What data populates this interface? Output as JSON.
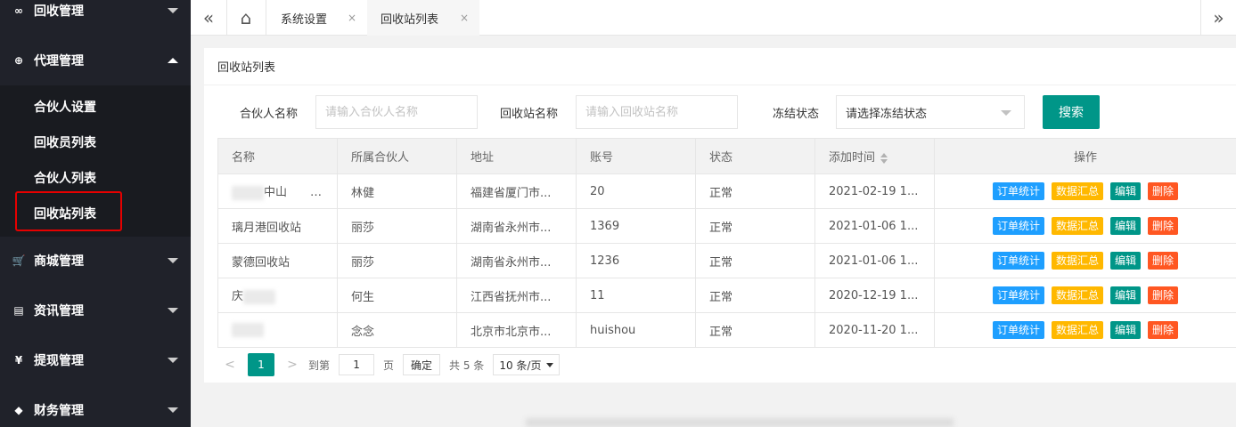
{
  "sidebar": {
    "menus": [
      {
        "label": "回收管理",
        "icon": "∞",
        "expanded": false
      },
      {
        "label": "代理管理",
        "icon": "⊕",
        "expanded": true
      },
      {
        "label": "商城管理",
        "icon": "🛒",
        "expanded": false
      },
      {
        "label": "资讯管理",
        "icon": "▤",
        "expanded": false
      },
      {
        "label": "提现管理",
        "icon": "¥",
        "expanded": false
      },
      {
        "label": "财务管理",
        "icon": "◆",
        "expanded": false
      }
    ],
    "submenu": [
      "合伙人设置",
      "回收员列表",
      "合伙人列表",
      "回收站列表"
    ]
  },
  "topbar": {
    "collapse_icon": "«",
    "home_icon": "⌂",
    "expand_icon": "»",
    "tabs": [
      {
        "label": "系统设置",
        "close": "×"
      },
      {
        "label": "回收站列表",
        "close": "×"
      }
    ]
  },
  "card": {
    "title": "回收站列表",
    "filters": {
      "partner_label": "合伙人名称",
      "partner_placeholder": "请输入合伙人名称",
      "station_label": "回收站名称",
      "station_placeholder": "请输入回收站名称",
      "freeze_label": "冻结状态",
      "freeze_value": "请选择冻结状态",
      "search_button": "搜索"
    }
  },
  "table": {
    "headers": [
      "名称",
      "所属合伙人",
      "地址",
      "账号",
      "状态",
      "添加时间",
      "操作"
    ],
    "actions": [
      "订单统计",
      "数据汇总",
      "编辑",
      "删除"
    ],
    "rows": [
      {
        "name": "中山　　园附近",
        "partner": "林健",
        "address": "福建省厦门市...",
        "account": "20",
        "status": "正常",
        "time": "2021-02-19 1..."
      },
      {
        "name": "璃月港回收站",
        "partner": "丽莎",
        "address": "湖南省永州市...",
        "account": "1369",
        "status": "正常",
        "time": "2021-01-06 1..."
      },
      {
        "name": "蒙德回收站",
        "partner": "丽莎",
        "address": "湖南省永州市...",
        "account": "1236",
        "status": "正常",
        "time": "2021-01-06 1..."
      },
      {
        "name": "庆",
        "partner": "何生",
        "address": "江西省抚州市...",
        "account": "11",
        "status": "正常",
        "time": "2020-12-19 1..."
      },
      {
        "name": "",
        "partner": "念念",
        "address": "北京市北京市...",
        "account": "huishou",
        "status": "正常",
        "time": "2020-11-20 1..."
      }
    ]
  },
  "pager": {
    "prev": "<",
    "current": "1",
    "next": ">",
    "goto_label": "到第",
    "goto_value": "1",
    "page_label": "页",
    "ok": "确定",
    "total": "共 5 条",
    "size": "10 条/页"
  },
  "colors": {
    "sidebar": "#20222a",
    "primary": "#009688",
    "blue": "#1e9fff",
    "yellow": "#ffb800",
    "red": "#ff5722"
  }
}
